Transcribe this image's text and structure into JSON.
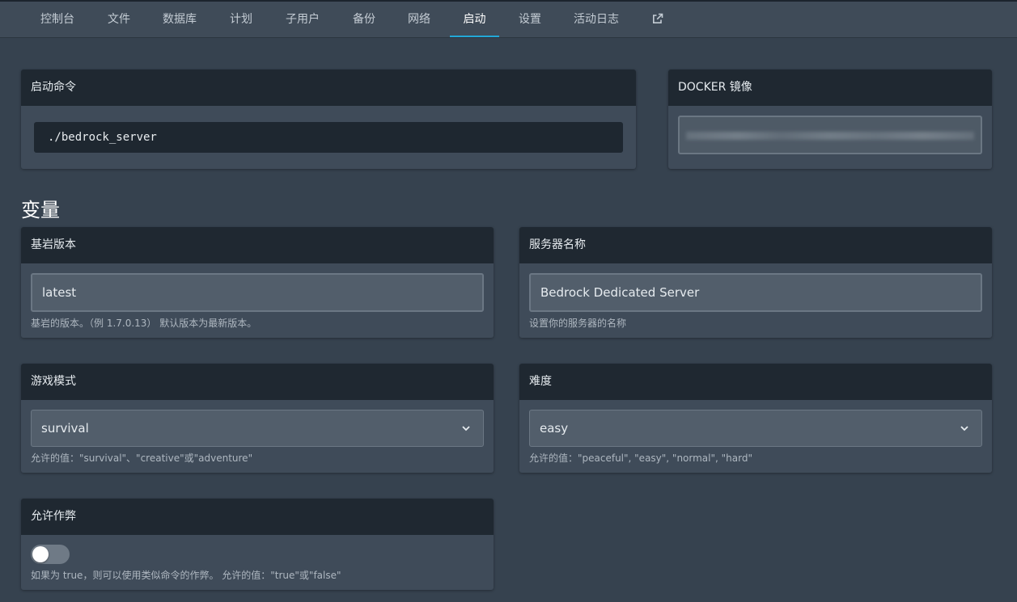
{
  "nav": {
    "tabs": [
      {
        "label": "控制台",
        "active": false
      },
      {
        "label": "文件",
        "active": false
      },
      {
        "label": "数据库",
        "active": false
      },
      {
        "label": "计划",
        "active": false
      },
      {
        "label": "子用户",
        "active": false
      },
      {
        "label": "备份",
        "active": false
      },
      {
        "label": "网络",
        "active": false
      },
      {
        "label": "启动",
        "active": true
      },
      {
        "label": "设置",
        "active": false
      },
      {
        "label": "活动日志",
        "active": false
      }
    ],
    "external_icon": "external-link-icon"
  },
  "startup": {
    "title": "启动命令",
    "command": "./bedrock_server"
  },
  "docker": {
    "title": "DOCKER 镜像"
  },
  "variables": {
    "title": "变量",
    "items": [
      {
        "title": "基岩版本",
        "value": "latest",
        "help": "基岩的版本。（例 1.7.0.13） 默认版本为最新版本。"
      },
      {
        "title": "服务器名称",
        "value": "Bedrock Dedicated Server",
        "help": "设置你的服务器的名称"
      },
      {
        "title": "游戏模式",
        "value": "survival",
        "help": "允许的值：\"survival\"、\"creative\"或\"adventure\""
      },
      {
        "title": "难度",
        "value": "easy",
        "help": "允许的值：\"peaceful\", \"easy\", \"normal\", \"hard\""
      },
      {
        "title": "允许作弊",
        "value": "false",
        "help": "如果为 true，则可以使用类似命令的作弊。 允许的值：\"true\"或\"false\""
      }
    ]
  },
  "colors": {
    "background": "#36424f",
    "card_header": "#1f2831",
    "accent": "#22a8d8"
  }
}
